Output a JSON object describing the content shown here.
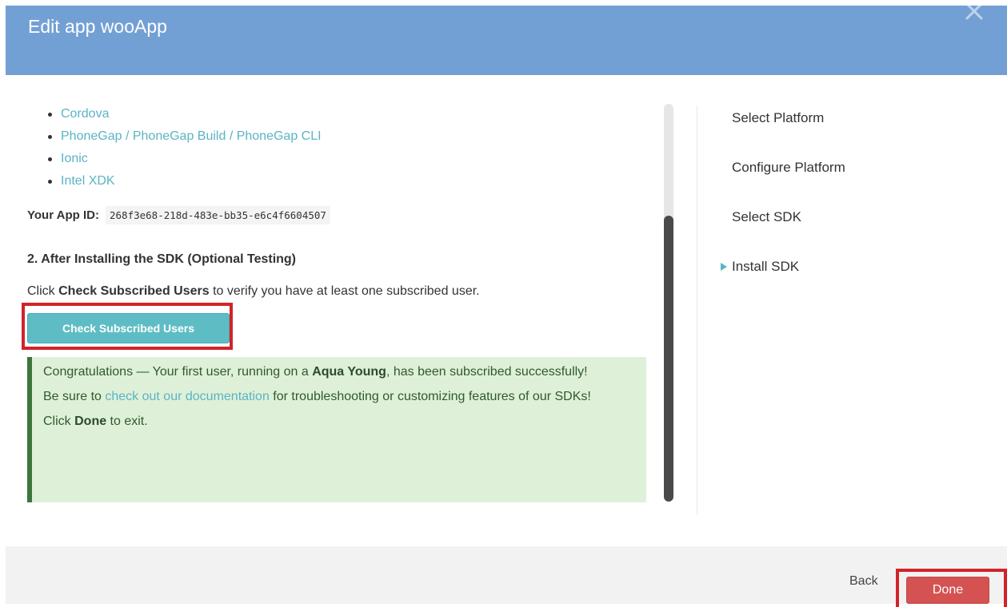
{
  "modal": {
    "title": "Edit app wooApp",
    "close_icon": "close-icon"
  },
  "sdk_links": [
    "Cordova",
    "PhoneGap / PhoneGap Build / PhoneGap CLI",
    "Ionic",
    "Intel XDK"
  ],
  "app_id": {
    "label": "Your App ID:",
    "value": "268f3e68-218d-483e-bb35-e6c4f6604507"
  },
  "step2": {
    "heading": "2. After Installing the SDK (Optional Testing)",
    "text_before": "Click ",
    "text_bold": "Check Subscribed Users",
    "text_after": " to verify you have at least one subscribed user.",
    "button_label": "Check Subscribed Users"
  },
  "success": {
    "line1_before": "Congratulations — Your first user, running on a ",
    "line1_bold": "Aqua Young",
    "line1_after": ", has been subscribed successfully!",
    "line2_before": "Be sure to ",
    "line2_link": "check out our documentation",
    "line2_after": " for troubleshooting or customizing features of our SDKs!",
    "line3_before": "Click ",
    "line3_bold": "Done",
    "line3_after": " to exit."
  },
  "steps_nav": {
    "items": [
      "Select Platform",
      "Configure Platform",
      "Select SDK",
      "Install SDK"
    ],
    "active_index": 3,
    "active_color": "#5ab4c4"
  },
  "footer": {
    "back_label": "Back",
    "done_label": "Done"
  },
  "colors": {
    "header": "#73a0d4",
    "link": "#5ab4c4",
    "primary_button": "#5ebdc4",
    "done_button": "#d55252",
    "success_bg": "#dff0d8",
    "success_border": "#3c763d",
    "highlight_border": "#d2232a"
  }
}
